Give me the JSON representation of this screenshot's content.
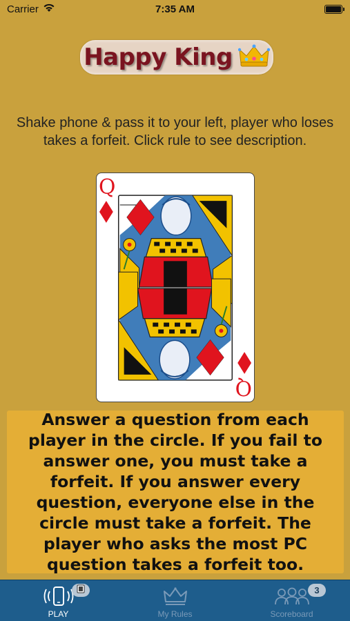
{
  "status_bar": {
    "carrier": "Carrier",
    "time": "7:35 AM"
  },
  "header": {
    "title": "Happy King",
    "title_emoji": "crown-icon"
  },
  "instructions": "Shake phone & pass it to your left, player who loses takes a forfeit. Click rule to see description.",
  "card": {
    "rank": "Q",
    "suit": "diamonds",
    "suit_color": "#E0141E"
  },
  "rule": {
    "text": "Answer a question from each player in the circle. If you fail to answer one, you must take a forfeit. If you answer every question, everyone else in the circle must take a forfeit. The player who asks the most PC question takes a forfeit too."
  },
  "tabbar": {
    "tabs": [
      {
        "label": "PLAY",
        "icon": "shake-phone-icon",
        "badge": "card-icon",
        "active": true
      },
      {
        "label": "My Rules",
        "icon": "crown-outline-icon",
        "active": false
      },
      {
        "label": "Scoreboard",
        "icon": "group-icon",
        "badge": "3",
        "active": false
      }
    ]
  },
  "colors": {
    "background": "#C9A13D",
    "rule_box": "#E4AE36",
    "tabbar": "#1E5D8C",
    "title_text": "#7A1420"
  }
}
